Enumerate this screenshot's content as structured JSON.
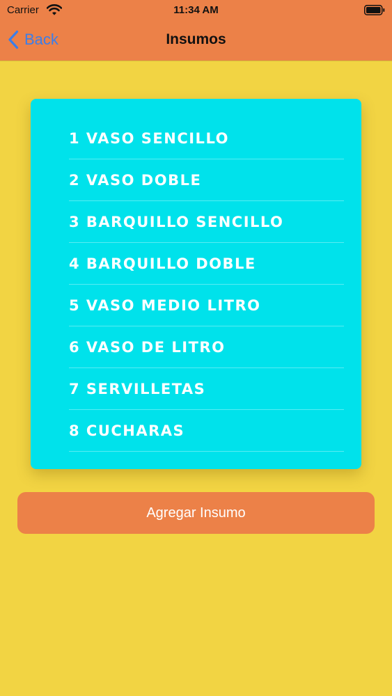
{
  "status_bar": {
    "carrier": "Carrier",
    "time": "11:34 AM"
  },
  "nav": {
    "back_label": "Back",
    "title": "Insumos"
  },
  "insumos": [
    "1 VASO SENCILLO",
    "2 VASO DOBLE",
    "3 BARQUILLO SENCILLO",
    "4 BARQUILLO DOBLE",
    "5 VASO MEDIO LITRO",
    "6 VASO DE LITRO",
    "7 SERVILLETAS",
    "8 CUCHARAS"
  ],
  "add_button_label": "Agregar Insumo",
  "colors": {
    "background": "#F2D443",
    "bar": "#EC8148",
    "card": "#00E2EB",
    "back_tint": "#3C7EE8"
  }
}
